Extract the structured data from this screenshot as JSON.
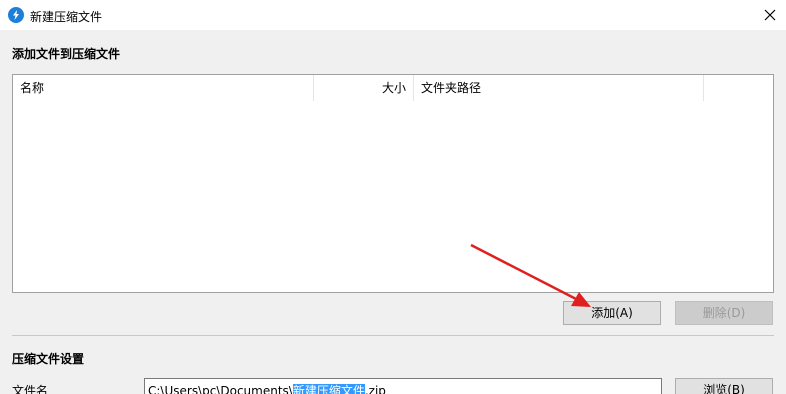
{
  "window": {
    "title": "新建压缩文件",
    "app_icon": "bandizip-icon",
    "close_symbol": "✕"
  },
  "add_section": {
    "heading": "添加文件到压缩文件",
    "columns": [
      "名称",
      "大小",
      "文件夹路径"
    ],
    "rows": [],
    "add_button": "添加(A)",
    "delete_button": "删除(D)"
  },
  "settings_section": {
    "heading": "压缩文件设置",
    "filename_label": "文件名",
    "filename_prefix": "C:\\Users\\pc\\Documents\\",
    "filename_selected": "新建压缩文件",
    "filename_suffix": ".zip",
    "browse_button": "浏览(B)"
  },
  "annotation": {
    "arrow_color": "#e02020"
  },
  "colors": {
    "selection": "#3399ff",
    "accent": "#1e7fd8"
  }
}
